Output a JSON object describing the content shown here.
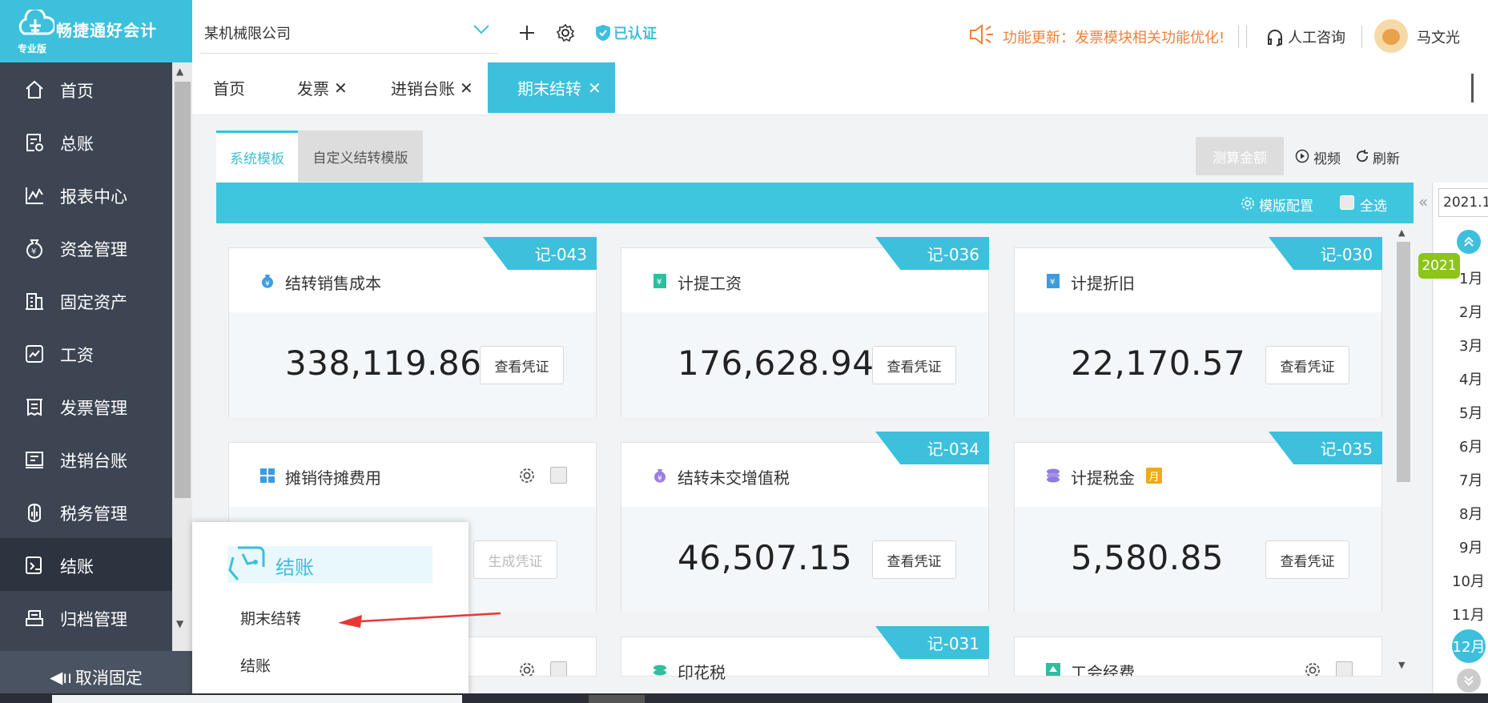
{
  "app": {
    "name": "畅捷通好会计",
    "edition": "专业版"
  },
  "sidebar": {
    "items": [
      {
        "label": "首页",
        "icon": "home-icon"
      },
      {
        "label": "总账",
        "icon": "ledger-icon"
      },
      {
        "label": "报表中心",
        "icon": "chart-icon"
      },
      {
        "label": "资金管理",
        "icon": "money-bag-icon"
      },
      {
        "label": "固定资产",
        "icon": "building-icon"
      },
      {
        "label": "工资",
        "icon": "salary-icon"
      },
      {
        "label": "发票管理",
        "icon": "invoice-icon"
      },
      {
        "label": "进销台账",
        "icon": "account-book-icon"
      },
      {
        "label": "税务管理",
        "icon": "tax-icon"
      },
      {
        "label": "结账",
        "icon": "close-account-icon",
        "active": true
      },
      {
        "label": "归档管理",
        "icon": "archive-icon"
      }
    ],
    "unpin_label": "取消固定"
  },
  "topbar": {
    "company": "某机械限公司",
    "verified": "已认证",
    "notice": "功能更新：发票模块相关功能优化!",
    "consult": "人工咨询",
    "user": "马文光"
  },
  "tabs": [
    {
      "label": "首页",
      "closable": false
    },
    {
      "label": "发票",
      "closable": true
    },
    {
      "label": "进销台账",
      "closable": true
    },
    {
      "label": "期末结转",
      "closable": true,
      "active": true
    }
  ],
  "subtabs": {
    "system": "系统模板",
    "custom": "自定义结转模版"
  },
  "toolbar": {
    "calc": "测算金额",
    "video": "视频",
    "refresh": "刷新",
    "template_config": "模版配置",
    "select_all": "全选"
  },
  "cards": [
    {
      "title": "结转销售成本",
      "amount": "338,119.86",
      "tag": "记-043",
      "button": "查看凭证"
    },
    {
      "title": "计提工资",
      "amount": "176,628.94",
      "tag": "记-036",
      "button": "查看凭证"
    },
    {
      "title": "计提折旧",
      "amount": "22,170.57",
      "tag": "记-030",
      "button": "查看凭证"
    },
    {
      "title": "摊销待摊费用",
      "amount": "",
      "tag": "",
      "button": "生成凭证"
    },
    {
      "title": "结转未交增值税",
      "amount": "46,507.15",
      "tag": "记-034",
      "button": "查看凭证"
    },
    {
      "title": "计提税金",
      "amount": "5,580.85",
      "tag": "记-035",
      "button": "查看凭证",
      "badge": "月"
    },
    {
      "title": "",
      "amount": "",
      "tag": "",
      "button": ""
    },
    {
      "title": "印花税",
      "amount": "",
      "tag": "记-031",
      "button": ""
    },
    {
      "title": "工会经费",
      "amount": "",
      "tag": "",
      "button": ""
    }
  ],
  "period": {
    "year_value": "2021.1",
    "year_badge": "2021",
    "months": [
      "1月",
      "2月",
      "3月",
      "4月",
      "5月",
      "6月",
      "7月",
      "8月",
      "9月",
      "10月",
      "11月",
      "12月"
    ],
    "selected_month": "12月"
  },
  "popup": {
    "title": "结账",
    "items": [
      "期末结转",
      "结账"
    ]
  },
  "colors": {
    "accent": "#3cc0dc",
    "sidebar": "#3d4553",
    "notice": "#f0803c",
    "year_badge": "#8cc41a",
    "arrow": "#e53935"
  }
}
